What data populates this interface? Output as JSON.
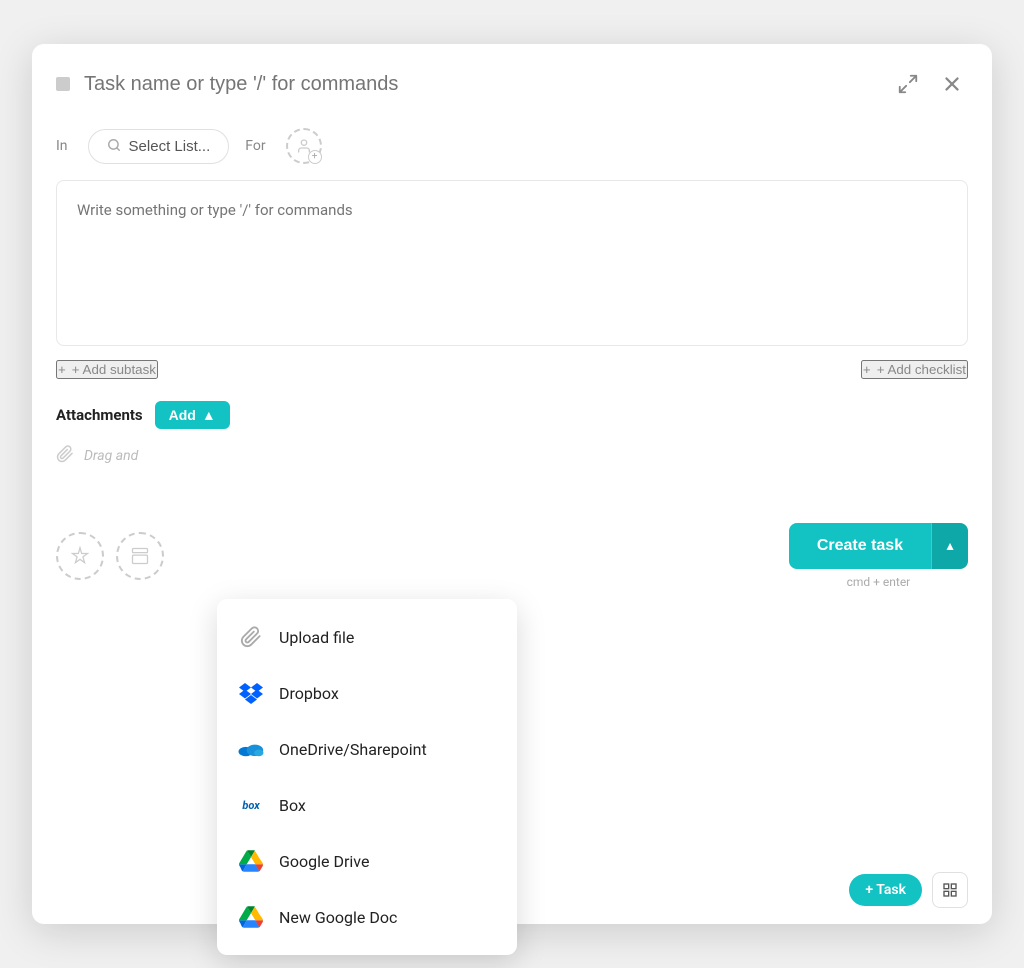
{
  "modal": {
    "task_name_placeholder": "Task name or type '/' for commands",
    "description_placeholder": "Write something or type '/' for commands",
    "select_list_placeholder": "Select List...",
    "in_label": "In",
    "for_label": "For",
    "add_subtask_label": "+ Add subtask",
    "add_checklist_label": "+ Add checklist",
    "attachments_label": "Attachments",
    "add_button_label": "Add",
    "drag_drop_text": "Drag and",
    "create_task_label": "Create task",
    "create_task_shortcut": "cmd + enter",
    "dropdown_items": [
      {
        "id": "upload-file",
        "label": "Upload file",
        "icon": "paperclip"
      },
      {
        "id": "dropbox",
        "label": "Dropbox",
        "icon": "dropbox"
      },
      {
        "id": "onedrive",
        "label": "OneDrive/Sharepoint",
        "icon": "onedrive"
      },
      {
        "id": "box",
        "label": "Box",
        "icon": "box"
      },
      {
        "id": "google-drive",
        "label": "Google Drive",
        "icon": "google-drive"
      },
      {
        "id": "new-google-doc",
        "label": "New Google Doc",
        "icon": "google-doc"
      }
    ],
    "bottom_bar": {
      "add_task_label": "+ Task"
    }
  }
}
